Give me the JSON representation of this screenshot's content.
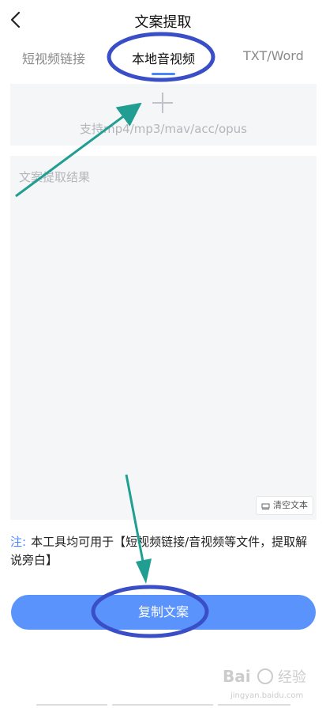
{
  "header": {
    "title": "文案提取",
    "back_icon": "chevron-left-icon"
  },
  "tabs": [
    {
      "label": "短视频链接",
      "active": false
    },
    {
      "label": "本地音视频",
      "active": true
    },
    {
      "label": "TXT/Word",
      "active": false
    }
  ],
  "upload": {
    "add_icon": "plus-icon",
    "formats": "支持mp4/mp3/mav/acc/opus"
  },
  "result": {
    "placeholder": "文案提取结果",
    "clear_label": "清空文本",
    "clear_icon": "eraser-icon"
  },
  "note": {
    "prefix": "注:",
    "text": "本工具均可用于【短视频链接/音视频等文件，提取解说旁白】"
  },
  "action": {
    "copy_label": "复制文案"
  },
  "watermark": {
    "text": "Bai经验",
    "subtext": "jingyan.baidu.com"
  },
  "colors": {
    "accent": "#5a93fb",
    "annotation": "#3a4fc7",
    "arrow": "#1f9e91"
  }
}
